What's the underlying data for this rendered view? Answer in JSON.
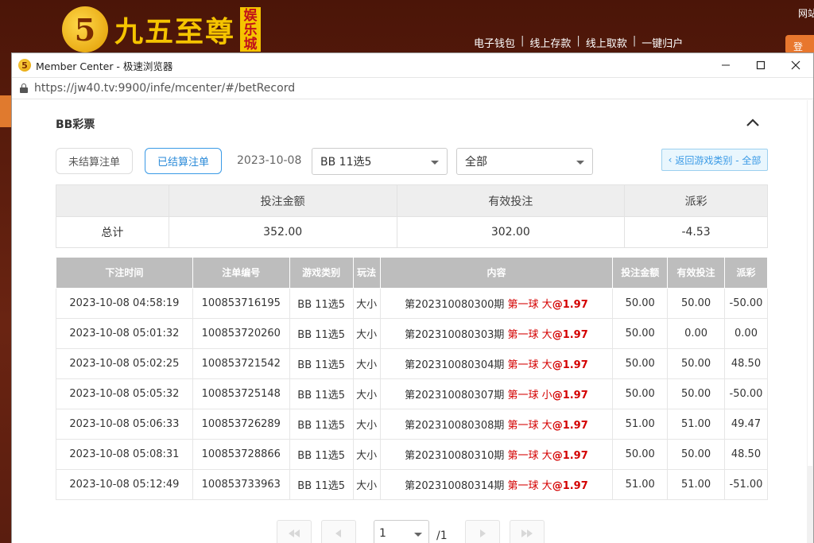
{
  "site": {
    "logo_char": "5",
    "logo_text": "九五至尊",
    "logo_badge": [
      "娱",
      "乐",
      "城"
    ],
    "nav": [
      "电子钱包",
      "线上存款",
      "线上取款",
      "一键归户"
    ],
    "topright": "网站",
    "login": "登"
  },
  "window": {
    "title": "Member Center - 极速浏览器",
    "url": "https://jw40.tv:9900/infe/mcenter/#/betRecord"
  },
  "section": {
    "title": "BB彩票"
  },
  "filters": {
    "unsettled_label": "未结算注单",
    "settled_label": "已结算注单",
    "date": "2023-10-08",
    "game_select": "BB 11选5",
    "type_select": "全部",
    "back_label": "返回游戏类别 - 全部"
  },
  "summary": {
    "headers": [
      "",
      "投注金额",
      "有效投注",
      "派彩"
    ],
    "row": {
      "label": "总计",
      "bet": "352.00",
      "valid": "302.00",
      "payout": "-4.53"
    }
  },
  "records": {
    "headers": [
      "下注时间",
      "注单编号",
      "游戏类别",
      "玩法",
      "内容",
      "投注金额",
      "有效投注",
      "派彩"
    ],
    "rows": [
      {
        "time": "2023-10-08 04:58:19",
        "id": "100853716195",
        "game": "BB 11选5",
        "play": "大小",
        "period": "第202310080300期",
        "ball": "第一球",
        "pick": "大",
        "odds": "@1.97",
        "bet": "50.00",
        "valid": "50.00",
        "payout": "-50.00",
        "neg": true
      },
      {
        "time": "2023-10-08 05:01:32",
        "id": "100853720260",
        "game": "BB 11选5",
        "play": "大小",
        "period": "第202310080303期",
        "ball": "第一球",
        "pick": "大",
        "odds": "@1.97",
        "bet": "50.00",
        "valid": "0.00",
        "payout": "0.00",
        "neg": false
      },
      {
        "time": "2023-10-08 05:02:25",
        "id": "100853721542",
        "game": "BB 11选5",
        "play": "大小",
        "period": "第202310080304期",
        "ball": "第一球",
        "pick": "大",
        "odds": "@1.97",
        "bet": "50.00",
        "valid": "50.00",
        "payout": "48.50",
        "neg": false
      },
      {
        "time": "2023-10-08 05:05:32",
        "id": "100853725148",
        "game": "BB 11选5",
        "play": "大小",
        "period": "第202310080307期",
        "ball": "第一球",
        "pick": "小",
        "odds": "@1.97",
        "bet": "50.00",
        "valid": "50.00",
        "payout": "-50.00",
        "neg": true
      },
      {
        "time": "2023-10-08 05:06:33",
        "id": "100853726289",
        "game": "BB 11选5",
        "play": "大小",
        "period": "第202310080308期",
        "ball": "第一球",
        "pick": "大",
        "odds": "@1.97",
        "bet": "51.00",
        "valid": "51.00",
        "payout": "49.47",
        "neg": false
      },
      {
        "time": "2023-10-08 05:08:31",
        "id": "100853728866",
        "game": "BB 11选5",
        "play": "大小",
        "period": "第202310080310期",
        "ball": "第一球",
        "pick": "大",
        "odds": "@1.97",
        "bet": "50.00",
        "valid": "50.00",
        "payout": "48.50",
        "neg": false
      },
      {
        "time": "2023-10-08 05:12:49",
        "id": "100853733963",
        "game": "BB 11选5",
        "play": "大小",
        "period": "第202310080314期",
        "ball": "第一球",
        "pick": "大",
        "odds": "@1.97",
        "bet": "51.00",
        "valid": "51.00",
        "payout": "-51.00",
        "neg": true
      }
    ]
  },
  "pagination": {
    "page": "1",
    "total": "/1"
  },
  "colors": {
    "accent": "#3a9ae6",
    "negative": "#e84040",
    "highlight": "#d40000",
    "header_gray": "#bdbdbd"
  }
}
